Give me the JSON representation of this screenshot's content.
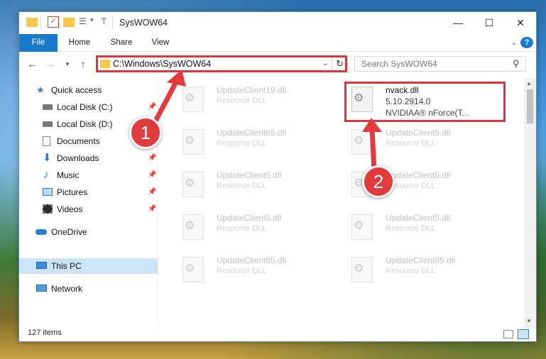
{
  "window": {
    "title": "SysWOW64"
  },
  "ribbon": {
    "tabs": [
      "File",
      "Home",
      "Share",
      "View"
    ]
  },
  "address": {
    "path": "C:\\Windows\\SysWOW64"
  },
  "search": {
    "placeholder": "Search SysWOW64"
  },
  "sidebar": {
    "items": [
      {
        "label": "Quick access",
        "icon": "star-icon",
        "pinned": false
      },
      {
        "label": "Local Disk (C:)",
        "icon": "drive-icon",
        "pinned": true
      },
      {
        "label": "Local Disk (D:)",
        "icon": "drive-icon",
        "pinned": true
      },
      {
        "label": "Documents",
        "icon": "documents-icon",
        "pinned": true
      },
      {
        "label": "Downloads",
        "icon": "download-icon",
        "pinned": true
      },
      {
        "label": "Music",
        "icon": "music-icon",
        "pinned": true
      },
      {
        "label": "Pictures",
        "icon": "pictures-icon",
        "pinned": true
      },
      {
        "label": "Videos",
        "icon": "videos-icon",
        "pinned": true
      },
      {
        "label": "OneDrive",
        "icon": "cloud-icon",
        "pinned": false
      },
      {
        "label": "This PC",
        "icon": "computer-icon",
        "pinned": false,
        "selected": true
      },
      {
        "label": "Network",
        "icon": "network-icon",
        "pinned": false
      }
    ]
  },
  "files": [
    {
      "name": "UpdateClient19.dll",
      "type": "Resource DLL"
    },
    {
      "name": "nvack.dll",
      "version": "5.10.2914.0",
      "company": "NVIDIAA® nForce(T...",
      "highlighted": true
    },
    {
      "name": "UpdateClient65.dll",
      "type": "Resource DLL"
    },
    {
      "name": "UpdateClient5.dll",
      "type": "Resource DLL"
    },
    {
      "name": "UpdateClient5.dll",
      "type": "Resource DLL"
    },
    {
      "name": "UpdateClient5.dll",
      "type": "Resource DLL"
    },
    {
      "name": "UpdateClient5.dll",
      "type": "Resource DLL"
    },
    {
      "name": "UpdateClient5.dll",
      "type": "Resource DLL"
    },
    {
      "name": "UpdateClient65.dll",
      "type": "Resource DLL"
    },
    {
      "name": "UpdateClient65.dll",
      "type": "Resource DLL"
    }
  ],
  "status": {
    "count": "127 items"
  },
  "annotations": {
    "step1": "1",
    "step2": "2",
    "color": "#e23b3e"
  }
}
